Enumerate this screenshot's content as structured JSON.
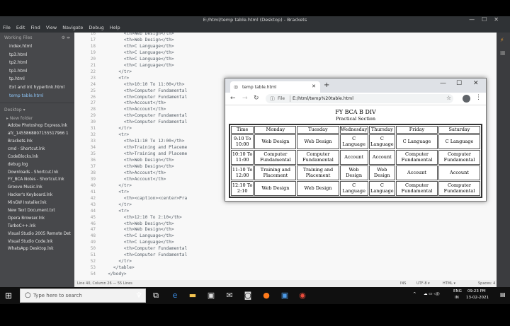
{
  "window": {
    "title": "E:/html/temp table.html (Desktop) - Brackets",
    "controls": [
      "—",
      "☐",
      "✕"
    ]
  },
  "menu": [
    "File",
    "Edit",
    "Find",
    "View",
    "Navigate",
    "Debug",
    "Help"
  ],
  "sidebar": {
    "working_files_label": "Working Files",
    "working_files": [
      "index.html",
      "tp3.html",
      "tp2.html",
      "tp1.html",
      "tp.html",
      "Ext and int hyperlink.html",
      "temp table.html"
    ],
    "active_file": "temp table.html",
    "project_label": "Desktop",
    "folder": "New folder",
    "files": [
      "Adobe Photoshop Express.lnk",
      "afc_1455868807155517966 1",
      "Brackets.lnk",
      "cmd - Shortcut.lnk",
      "CodeBlocks.lnk",
      "debug.log",
      "Downloads - Shortcut.lnk",
      "FY_BCA Notes - Shortcut.lnk",
      "Groove Music.lnk",
      "Hacker's Keyboard.lnk",
      "MinGW Installer.lnk",
      "New Text Document.txt",
      "Opera Browser.lnk",
      "TurboC++.lnk",
      "Visual Studio 2005 Remote Det",
      "Visual Studio Code.lnk",
      "WhatsApp Desktop.lnk"
    ]
  },
  "editor": {
    "line_numbers": [
      "16",
      "17",
      "18",
      "19",
      "20",
      "21",
      "22",
      "23",
      "24",
      "25",
      "26",
      "27",
      "28",
      "29",
      "30",
      "31",
      "32",
      "33",
      "34",
      "35",
      "36",
      "37",
      "38",
      "39",
      "40",
      "41",
      "42",
      "43",
      "44",
      "45",
      "46",
      "47",
      "48",
      "49",
      "50",
      "51",
      "52",
      "53",
      "54"
    ],
    "lines": [
      "        <th>Web Design</th>",
      "        <th>Web Design</th>",
      "        <th>C Language</th>",
      "        <th>C Language</th>",
      "        <th>C Language</th>",
      "        <th>C Language</th>",
      "      </tr>",
      "      <tr>",
      "        <th>10:10 To 11:00</th>",
      "        <th>Computer Fundamental",
      "        <th>Computer Fundamental",
      "        <th>Account</th>",
      "        <th>Account</th>",
      "        <th>Computer Fundamental",
      "        <th>Computer Fundamental",
      "      </tr>",
      "      <tr>",
      "        <th>11:10 To 12:00</th>",
      "        <th>Training and Placeme",
      "        <th>Training and Placeme",
      "        <th>Web Design</th>",
      "        <th>Web Design</th>",
      "        <th>Account</th>",
      "        <th>Account</th>",
      "      </tr>",
      "      <tr>",
      "        <th><caption><center>Pra",
      "      </tr>",
      "      <tr>",
      "        <th>12:10 To 2:10</th>",
      "        <th>Web Design</th>",
      "        <th>Web Design</th>",
      "        <th>C Language</th>",
      "        <th>C Language</th>",
      "        <th>Computer Fundamental",
      "        <th>Computer Fundamental",
      "      </tr>",
      "    </table>",
      "  </body>"
    ]
  },
  "statusbar": {
    "position": "Line 40, Column 26 — 55 Lines",
    "mode": "INS",
    "encoding": "UTF-8 ▾",
    "language": "HTML ▾",
    "spaces": "Spaces: 4"
  },
  "browser": {
    "tab_title": "temp table.html",
    "new_tab": "+",
    "file_label": "File",
    "url": "E:/html/temp%20table.html",
    "caption_title": "FY BCA B DIV",
    "caption_sub": "Practical Section",
    "headers": [
      "Time",
      "Monday",
      "Tuesday",
      "Wednesday",
      "Thursday",
      "Friday",
      "Saturday"
    ],
    "rows": [
      [
        "9:10 To 10:00",
        "Web Design",
        "Web Design",
        "C Language",
        "C Language",
        "C Language",
        "C Language"
      ],
      [
        "10:10 To 11:00",
        "Computer Fundamental",
        "Computer Fundamental",
        "Account",
        "Account",
        "Computer Fundamental",
        "Computer Fundamental"
      ],
      [
        "11:10 To 12:00",
        "Training and Placement",
        "Training and Placement",
        "Web Design",
        "Web Design",
        "Account",
        "Account"
      ],
      [
        "12:10 To 2:10",
        "Web Design",
        "Web Design",
        "C Language",
        "C Language",
        "Computer Fundamental",
        "Computer Fundamental"
      ]
    ]
  },
  "taskbar": {
    "search_placeholder": "Type here to search",
    "lang": "ENG",
    "region": "IN",
    "time": "09:23 PM",
    "date": "13-02-2021"
  }
}
